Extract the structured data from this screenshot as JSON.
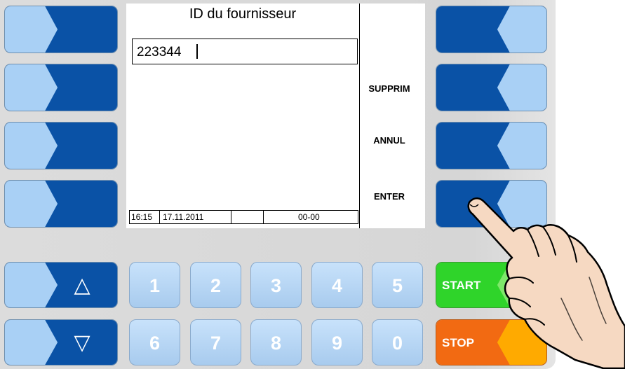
{
  "screen": {
    "title": "ID du fournisseur",
    "input_value": "223344",
    "softkeys": [
      "SUPPRIM",
      "ANNUL",
      "ENTER"
    ],
    "status": {
      "time": "16:15",
      "date": "17.11.2011",
      "code": "00-00"
    }
  },
  "keypad": {
    "row1": [
      "1",
      "2",
      "3",
      "4",
      "5"
    ],
    "row2": [
      "6",
      "7",
      "8",
      "9",
      "0"
    ]
  },
  "nav": {
    "up_icon": "triangle-up-icon",
    "down_icon": "triangle-down-icon",
    "up_glyph": "△",
    "down_glyph": "▽"
  },
  "actions": {
    "start_label": "START",
    "stop_label": "STOP"
  },
  "colors": {
    "light_blue": "#a9d0f5",
    "dark_blue": "#0a52a6",
    "start_green": "#2fd42a",
    "stop_orange": "#f26a12",
    "stop_accent": "#ffaa00"
  }
}
